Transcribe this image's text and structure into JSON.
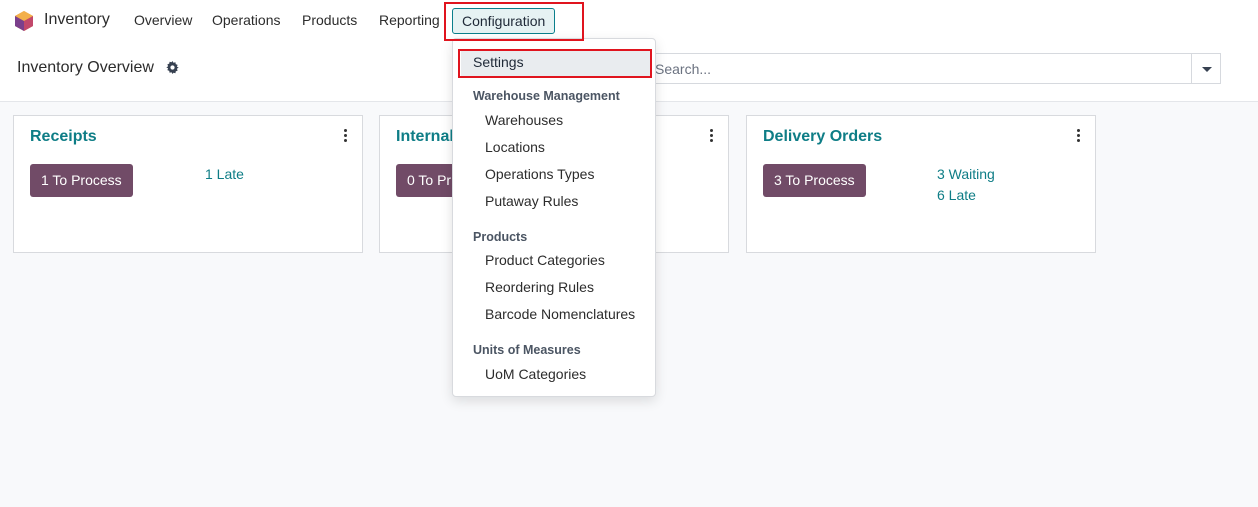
{
  "navbar": {
    "app_name": "Inventory",
    "menu": [
      "Overview",
      "Operations",
      "Products",
      "Reporting",
      "Configuration"
    ]
  },
  "control": {
    "title": "Inventory Overview",
    "search_placeholder": "Search..."
  },
  "cards": [
    {
      "title": "Receipts",
      "button": "1 To Process",
      "links": [
        "1 Late"
      ]
    },
    {
      "title": "Internal",
      "button": "0 To Pr",
      "links": []
    },
    {
      "title": "Delivery Orders",
      "button": "3 To Process",
      "links": [
        "3 Waiting",
        "6 Late"
      ]
    }
  ],
  "dropdown": {
    "settings": "Settings",
    "sections": [
      {
        "header": "Warehouse Management",
        "items": [
          "Warehouses",
          "Locations",
          "Operations Types",
          "Putaway Rules"
        ]
      },
      {
        "header": "Products",
        "items": [
          "Product Categories",
          "Reordering Rules",
          "Barcode Nomenclatures"
        ]
      },
      {
        "header": "Units of Measures",
        "items": [
          "UoM Categories"
        ]
      }
    ]
  },
  "colors": {
    "accent": "#0e7d86",
    "button": "#714b67",
    "highlight": "#e0141e"
  }
}
